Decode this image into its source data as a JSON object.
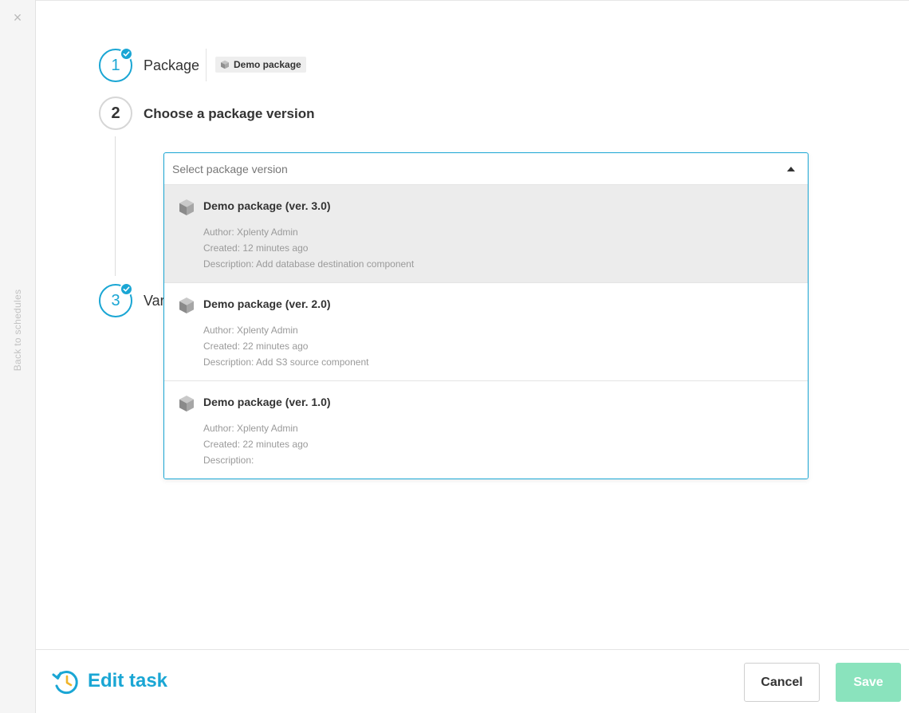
{
  "sidebar": {
    "close_glyph": "×",
    "back_link": "Back to schedules"
  },
  "steps": [
    {
      "number": "1",
      "label": "Package",
      "chip": "Demo package",
      "status": "done"
    },
    {
      "number": "2",
      "label": "Choose a package version",
      "status": "active"
    },
    {
      "number": "3",
      "label": "Var",
      "status": "done"
    }
  ],
  "version_select": {
    "placeholder": "Select package version",
    "value": "",
    "options": [
      {
        "title": "Demo package (ver. 3.0)",
        "author": "Author: Xplenty Admin",
        "created": "Created: 12 minutes ago",
        "description": "Description: Add database destination component",
        "highlighted": true
      },
      {
        "title": "Demo package (ver. 2.0)",
        "author": "Author: Xplenty Admin",
        "created": "Created: 22 minutes ago",
        "description": "Description: Add S3 source component",
        "highlighted": false
      },
      {
        "title": "Demo package (ver. 1.0)",
        "author": "Author: Xplenty Admin",
        "created": "Created: 22 minutes ago",
        "description": "Description:",
        "highlighted": false
      }
    ]
  },
  "footer": {
    "title": "Edit task",
    "cancel_label": "Cancel",
    "save_label": "Save"
  },
  "icons": {
    "close": "close-icon",
    "check": "check-icon",
    "package": "package-cube-icon",
    "caret": "caret-up-icon",
    "edit_task": "clock-history-icon"
  },
  "colors": {
    "accent": "#1aa6d4",
    "save_button": "#7ee0b6",
    "highlight_row": "#ececec"
  }
}
